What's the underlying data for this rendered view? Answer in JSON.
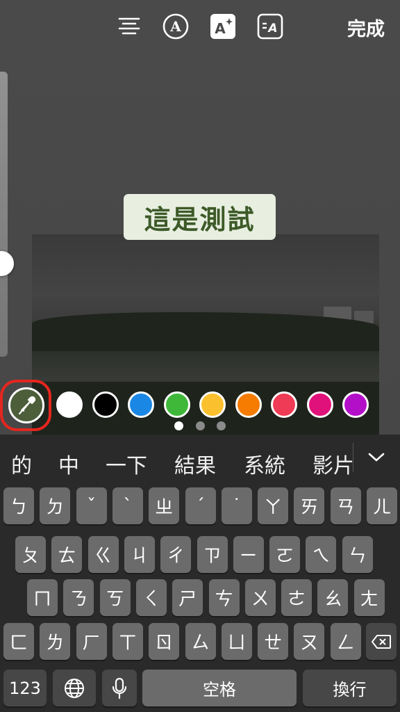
{
  "toolbar": {
    "done_label": "完成",
    "tools": [
      {
        "icon": "align-center-icon"
      },
      {
        "icon": "font-style-icon"
      },
      {
        "icon": "text-effect-icon"
      },
      {
        "icon": "text-animation-icon"
      }
    ]
  },
  "sticker": {
    "text": "這是測試",
    "background": "#e8efe1",
    "color": "#3d5a28"
  },
  "palette": {
    "selected": "eyedropper",
    "colors": [
      "#ffffff",
      "#000000",
      "#1b87e5",
      "#3fb83a",
      "#fbc02d",
      "#f57c00",
      "#ef3b55",
      "#e0117a",
      "#b40fc8"
    ],
    "page_count": 3,
    "current_page": 1
  },
  "keyboard": {
    "candidates": [
      "的",
      "中",
      "一下",
      "結果",
      "系統",
      "影片"
    ],
    "rows": [
      [
        "ㄅ",
        "ㄉ",
        "ˇ",
        "ˋ",
        "ㄓ",
        "ˊ",
        "˙",
        "ㄚ",
        "ㄞ",
        "ㄢ",
        "ㄦ"
      ],
      [
        "ㄆ",
        "ㄊ",
        "ㄍ",
        "ㄐ",
        "ㄔ",
        "ㄗ",
        "ㄧ",
        "ㄛ",
        "ㄟ",
        "ㄣ"
      ],
      [
        "ㄇ",
        "ㄋ",
        "ㄎ",
        "ㄑ",
        "ㄕ",
        "ㄘ",
        "ㄨ",
        "ㄜ",
        "ㄠ",
        "ㄤ"
      ],
      [
        "ㄈ",
        "ㄌ",
        "ㄏ",
        "ㄒ",
        "ㄖ",
        "ㄙ",
        "ㄩ",
        "ㄝ",
        "ㄡ",
        "ㄥ"
      ]
    ],
    "bottom": {
      "numbers": "123",
      "space": "空格",
      "return": "換行"
    }
  }
}
